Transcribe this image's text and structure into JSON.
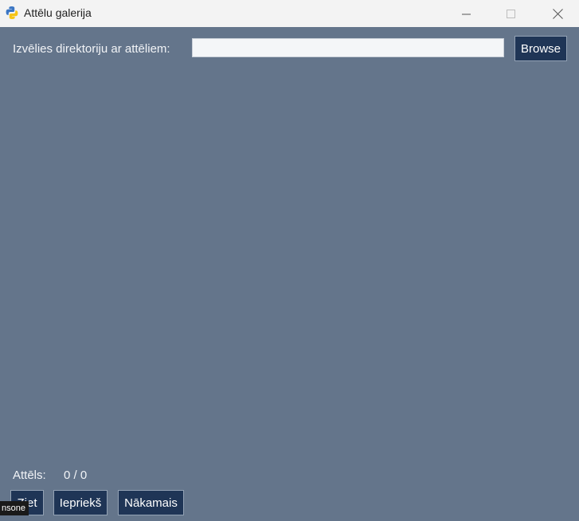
{
  "window": {
    "title": "Attēlu galerija",
    "controls": [
      "minimize-icon",
      "maximize-icon",
      "close-icon"
    ]
  },
  "directory": {
    "label": "Izvēlies direktoriju ar attēliem:",
    "value": "",
    "placeholder": "",
    "browse_label": "Browse"
  },
  "status": {
    "label": "Attēls:",
    "value": "0 / 0"
  },
  "nav": {
    "first_label": "Ziet",
    "prev_label": "Iepriekš",
    "next_label": "Nākamais"
  },
  "tooltip": {
    "text": "nsone"
  },
  "colors": {
    "background": "#64758b",
    "button": "#1f3556",
    "titlebar": "#f3f3f3"
  }
}
